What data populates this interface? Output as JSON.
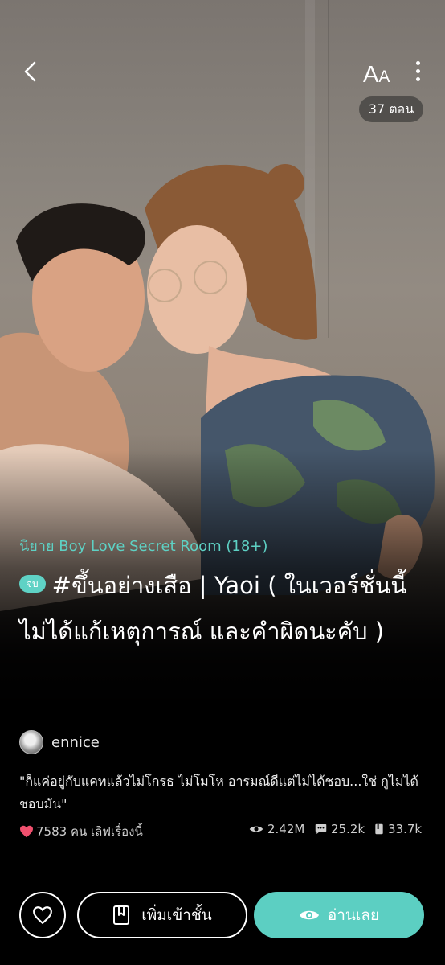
{
  "header": {
    "back_icon": "chevron-left-icon",
    "font_size_label_big": "A",
    "font_size_label_small": "A",
    "more_icon": "more-vertical-icon",
    "episode_count": "37 ตอน"
  },
  "cover": {
    "image": "cover-illustration"
  },
  "novel": {
    "category": "นิยาย Boy Love Secret Room (18+)",
    "status_badge": "จบ",
    "title": "#ขึ้นอย่างเสือ | Yaoi ( ในเวอร์ชั่นนี้ไม่ได้แก้เหตุการณ์ และคำผิดนะคับ )",
    "author": "ennice",
    "blurb": "\"ก็แค่อยู่กับแคทแล้วไม่โกรธ ไม่โมโห อารมณ์ดีแต่ไม่ได้ชอบ...ใช่ กูไม่ได้ชอบมัน\""
  },
  "stats": {
    "likes_text": "7583 คน เลิฟเรื่องนี้",
    "views": "2.42M",
    "comments": "25.2k",
    "library": "33.7k"
  },
  "actions": {
    "add_library_label": "เพิ่มเข้าชั้น",
    "read_label": "อ่านเลย"
  },
  "colors": {
    "accent": "#5ccfc2",
    "heart": "#f0506e"
  }
}
